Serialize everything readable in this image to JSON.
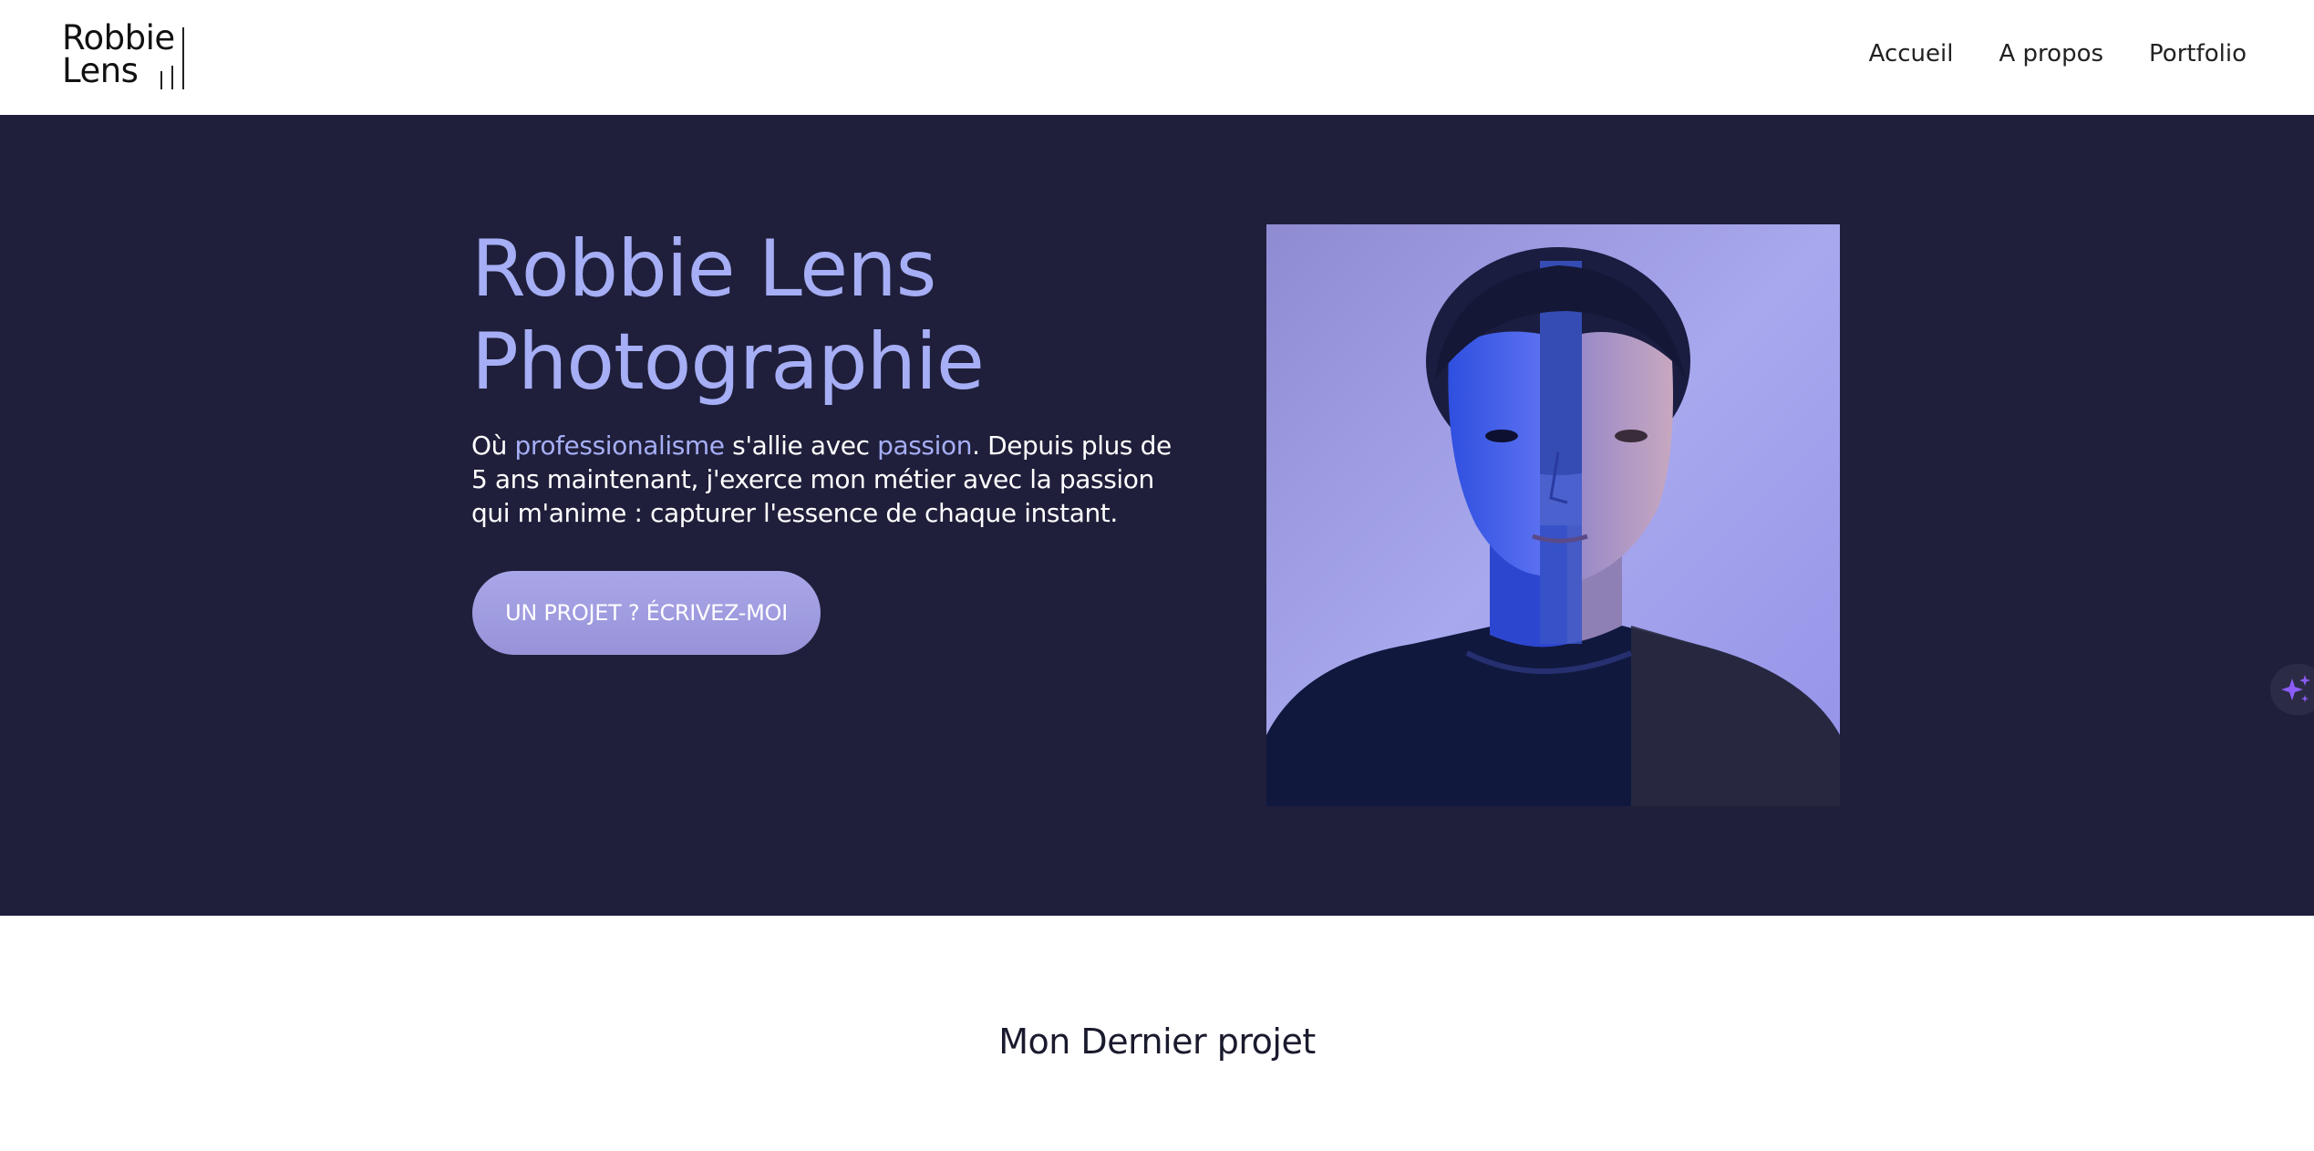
{
  "header": {
    "logo": {
      "line1": "Robbie",
      "line2": "Lens"
    },
    "nav": [
      {
        "label": "Accueil"
      },
      {
        "label": "A propos"
      },
      {
        "label": "Portfolio"
      }
    ]
  },
  "hero": {
    "title_line1": "Robbie Lens",
    "title_line2": "Photographie",
    "text": {
      "part1": "Où ",
      "accent1": "professionalisme",
      "part2": " s'allie avec ",
      "accent2": "passion",
      "part3": ". Depuis plus de 5 ans maintenant, j'exerce mon métier avec la passion qui m'anime : capturer l'essence de chaque instant."
    },
    "cta_label": "UN PROJET ? ÉCRIVEZ-MOI",
    "portrait_icon": "portrait-photo"
  },
  "floating": {
    "icon": "sparkle-icon"
  },
  "section": {
    "title": "Mon Dernier projet"
  },
  "colors": {
    "hero_bg": "#1f1f3b",
    "accent": "#a6aef5",
    "cta": "#a9a6e8"
  }
}
